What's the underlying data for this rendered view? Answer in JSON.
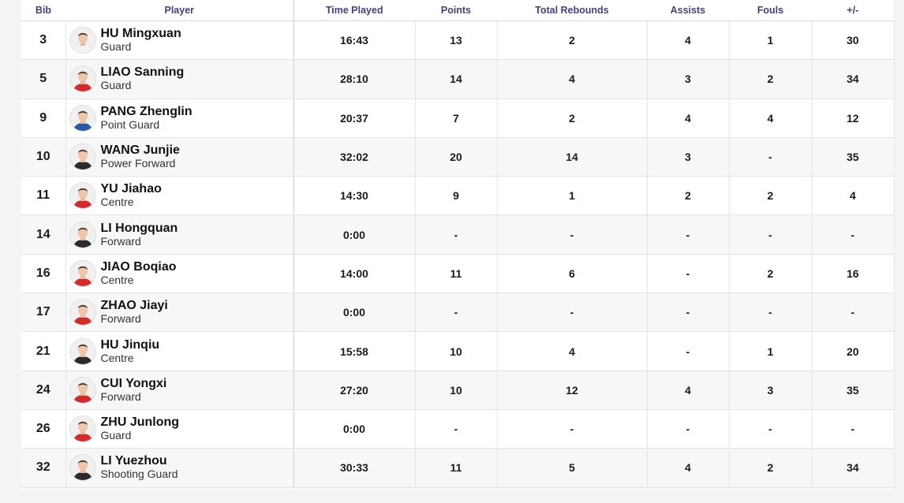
{
  "headers": {
    "bib": "Bib",
    "player": "Player",
    "time": "Time Played",
    "points": "Points",
    "rebounds": "Total Rebounds",
    "assists": "Assists",
    "fouls": "Fouls",
    "plus_minus": "+/-"
  },
  "colors": {
    "header_text": "#4a3b86",
    "jersey_red": "#d42a2a",
    "jersey_blue": "#2a5aa6",
    "jersey_black": "#2b2b2b",
    "jersey_white": "#f2f2f2"
  },
  "rows": [
    {
      "bib": "3",
      "name": "HU Mingxuan",
      "position": "Guard",
      "time": "16:43",
      "points": "13",
      "rebounds": "2",
      "assists": "4",
      "fouls": "1",
      "plus_minus": "30",
      "jersey": "white"
    },
    {
      "bib": "5",
      "name": "LIAO Sanning",
      "position": "Guard",
      "time": "28:10",
      "points": "14",
      "rebounds": "4",
      "assists": "3",
      "fouls": "2",
      "plus_minus": "34",
      "jersey": "red"
    },
    {
      "bib": "9",
      "name": "PANG Zhenglin",
      "position": "Point Guard",
      "time": "20:37",
      "points": "7",
      "rebounds": "2",
      "assists": "4",
      "fouls": "4",
      "plus_minus": "12",
      "jersey": "blue"
    },
    {
      "bib": "10",
      "name": "WANG Junjie",
      "position": "Power Forward",
      "time": "32:02",
      "points": "20",
      "rebounds": "14",
      "assists": "3",
      "fouls": "-",
      "plus_minus": "35",
      "jersey": "black"
    },
    {
      "bib": "11",
      "name": "YU Jiahao",
      "position": "Centre",
      "time": "14:30",
      "points": "9",
      "rebounds": "1",
      "assists": "2",
      "fouls": "2",
      "plus_minus": "4",
      "jersey": "red"
    },
    {
      "bib": "14",
      "name": "LI Hongquan",
      "position": "Forward",
      "time": "0:00",
      "points": "-",
      "rebounds": "-",
      "assists": "-",
      "fouls": "-",
      "plus_minus": "-",
      "jersey": "black"
    },
    {
      "bib": "16",
      "name": "JIAO Boqiao",
      "position": "Centre",
      "time": "14:00",
      "points": "11",
      "rebounds": "6",
      "assists": "-",
      "fouls": "2",
      "plus_minus": "16",
      "jersey": "red"
    },
    {
      "bib": "17",
      "name": "ZHAO Jiayi",
      "position": "Forward",
      "time": "0:00",
      "points": "-",
      "rebounds": "-",
      "assists": "-",
      "fouls": "-",
      "plus_minus": "-",
      "jersey": "red"
    },
    {
      "bib": "21",
      "name": "HU Jinqiu",
      "position": "Centre",
      "time": "15:58",
      "points": "10",
      "rebounds": "4",
      "assists": "-",
      "fouls": "1",
      "plus_minus": "20",
      "jersey": "black"
    },
    {
      "bib": "24",
      "name": "CUI Yongxi",
      "position": "Forward",
      "time": "27:20",
      "points": "10",
      "rebounds": "12",
      "assists": "4",
      "fouls": "3",
      "plus_minus": "35",
      "jersey": "red"
    },
    {
      "bib": "26",
      "name": "ZHU Junlong",
      "position": "Guard",
      "time": "0:00",
      "points": "-",
      "rebounds": "-",
      "assists": "-",
      "fouls": "-",
      "plus_minus": "-",
      "jersey": "red"
    },
    {
      "bib": "32",
      "name": "LI Yuezhou",
      "position": "Shooting Guard",
      "time": "30:33",
      "points": "11",
      "rebounds": "5",
      "assists": "4",
      "fouls": "2",
      "plus_minus": "34",
      "jersey": "black"
    }
  ]
}
